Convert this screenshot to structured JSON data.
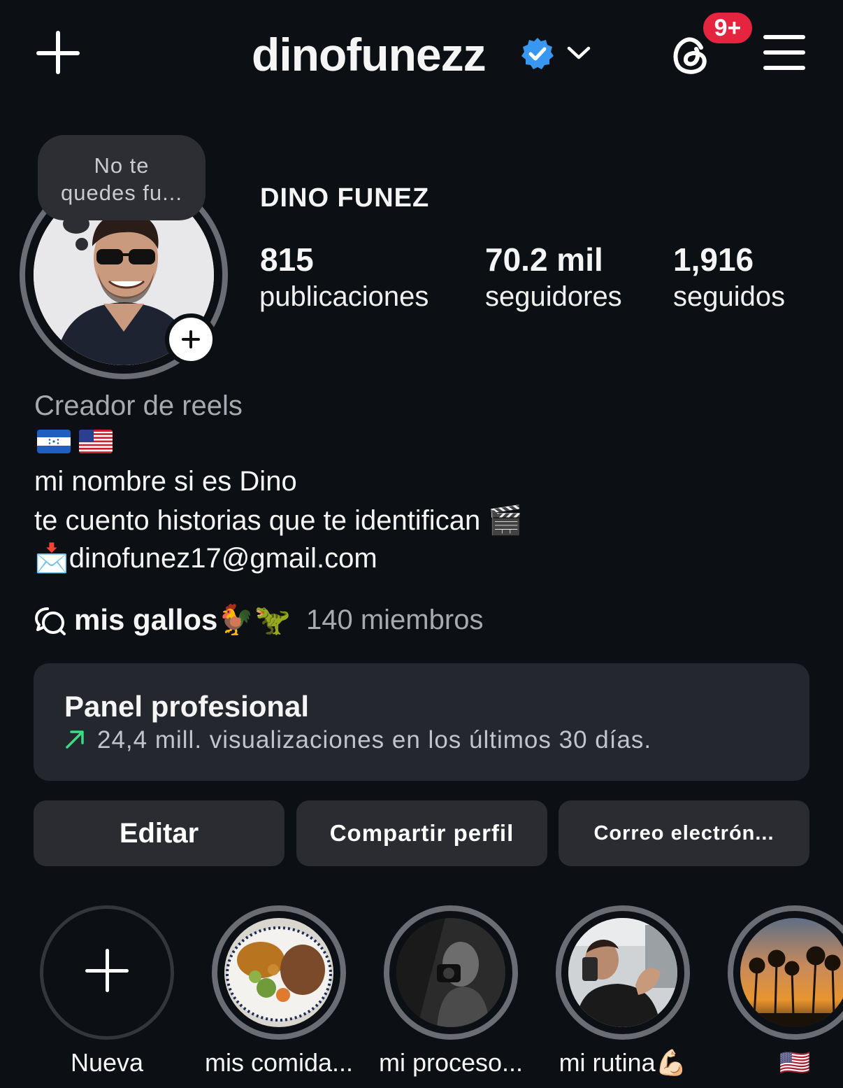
{
  "header": {
    "username": "dinofunezz",
    "notification_badge": "9+",
    "icons": [
      "plus-icon",
      "verified-badge-icon",
      "chevron-down-icon",
      "threads-icon",
      "menu-icon"
    ]
  },
  "note": {
    "text_line1": "No te",
    "text_line2": "quedes fu..."
  },
  "profile": {
    "display_name": "DINO FUNEZ",
    "stats": [
      {
        "value": "815",
        "label": "publicaciones"
      },
      {
        "value": "70.2 mil",
        "label": "seguidores"
      },
      {
        "value": "1,916",
        "label": "seguidos"
      }
    ],
    "category": "Creador de reels",
    "flags": [
      "Honduras",
      "United States"
    ],
    "bio": [
      "mi nombre si es Dino",
      "te cuento historias que te identifican 🎬",
      "📩dinofunez17@gmail.com"
    ]
  },
  "channel": {
    "name": "mis gallos🐓🦖",
    "members": "140 miembros"
  },
  "panel": {
    "title": "Panel profesional",
    "subtitle": "24,4 mill. visualizaciones en los últimos 30 días."
  },
  "buttons": {
    "edit": "Editar",
    "share": "Compartir perfil",
    "email": "Correo electrón..."
  },
  "highlights": [
    {
      "label": "Nueva"
    },
    {
      "label": "mis comida..."
    },
    {
      "label": "mi proceso..."
    },
    {
      "label": "mi rutina💪🏻"
    },
    {
      "label": "🇺🇸"
    }
  ],
  "colors": {
    "background": "#0c0f14",
    "surface": "#24272d",
    "button": "#2a2c32",
    "verified": "#3897f0",
    "badge": "#e5253f",
    "trend_arrow": "#3ddc84"
  }
}
